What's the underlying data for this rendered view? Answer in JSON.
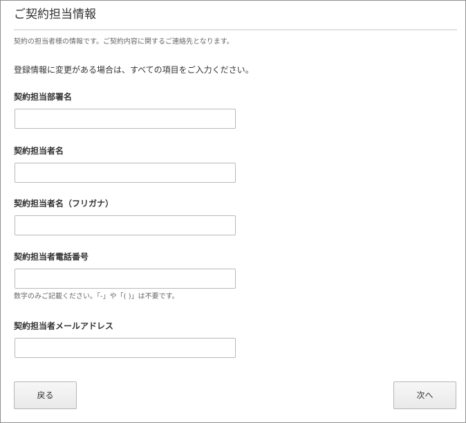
{
  "section": {
    "title": "ご契約担当情報",
    "description": "契約の担当者様の情報です。ご契約内容に関するご連絡先となります。",
    "notice": "登録情報に変更がある場合は、すべての項目をご入力ください。"
  },
  "fields": [
    {
      "label": "契約担当部署名",
      "value": ""
    },
    {
      "label": "契約担当者名",
      "value": ""
    },
    {
      "label": "契約担当者名（フリガナ）",
      "value": ""
    },
    {
      "label": "契約担当者電話番号",
      "value": "",
      "hint": "数字のみご記載ください。「-」や「( )」は不要です。"
    },
    {
      "label": "契約担当者メールアドレス",
      "value": ""
    }
  ],
  "buttons": {
    "back": "戻る",
    "next": "次へ"
  }
}
